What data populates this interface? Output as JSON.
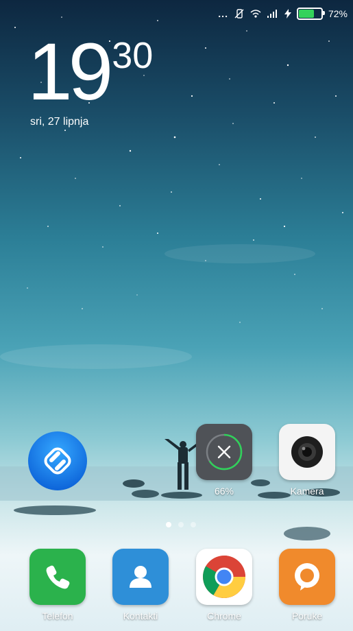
{
  "status_bar": {
    "dots": "...",
    "battery_percent": "72%",
    "battery_level": 0.72,
    "icons": [
      "dots-icon",
      "vibrate-icon",
      "wifi-icon",
      "signal-icon",
      "charging-icon",
      "battery-icon"
    ]
  },
  "clock": {
    "hours": "19",
    "minutes": "30",
    "date": "sri, 27 lipnja"
  },
  "widgets": {
    "cleaner_percent": "66%",
    "cleaner_level": 0.66
  },
  "apps": {
    "shazam": {
      "icon": "shazam-icon"
    },
    "camera": {
      "label": "Kamera",
      "icon": "camera-icon"
    }
  },
  "dock": [
    {
      "label": "Telefon",
      "icon": "phone-icon",
      "color": "#2bb24c"
    },
    {
      "label": "Kontakti",
      "icon": "contact-icon",
      "color": "#2e8fd8"
    },
    {
      "label": "Chrome",
      "icon": "chrome-icon",
      "color": "#ffffff"
    },
    {
      "label": "Poruke",
      "icon": "message-icon",
      "color": "#f08a2c"
    }
  ],
  "pages": {
    "count": 3,
    "active": 0
  }
}
